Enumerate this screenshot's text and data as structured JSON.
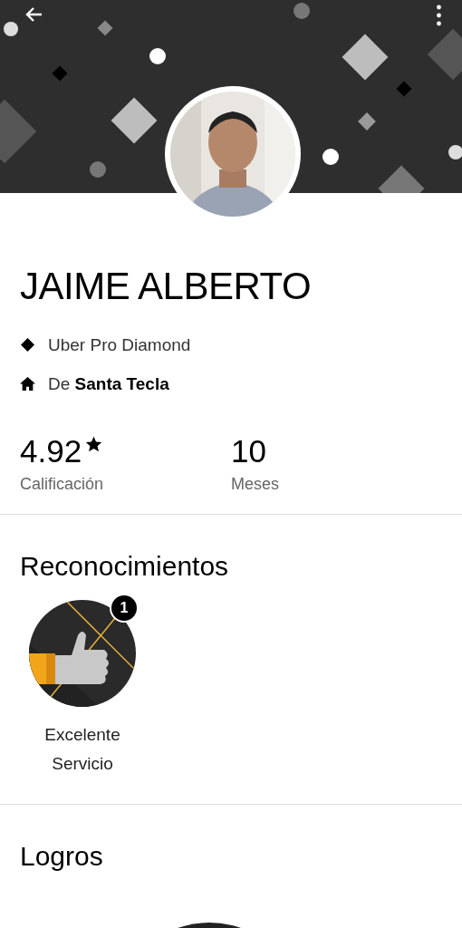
{
  "profile": {
    "name": "JAIME ALBERTO",
    "tier": "Uber Pro Diamond",
    "hometown": "De **Santa Tecla**"
  },
  "stats": [
    {
      "value": "4.92",
      "label": "Calificación",
      "star": true
    },
    {
      "value": "10",
      "label": "Meses",
      "star": false
    }
  ],
  "recognitions": {
    "title": "Reconocimientos",
    "items": [
      {
        "label": "Excelente Servicio",
        "count": "1"
      }
    ]
  },
  "achievements": {
    "title": "Logros"
  }
}
